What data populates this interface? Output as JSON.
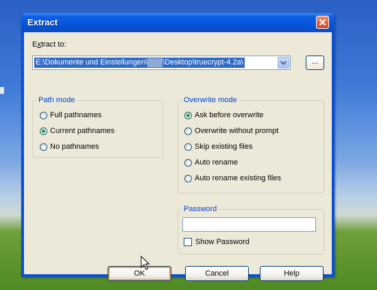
{
  "window": {
    "title": "Extract"
  },
  "extract_to": {
    "label_pre": "E",
    "label_u": "x",
    "label_post": "tract to:",
    "path_start": "E:\\Dokumente und Einstellungen\\",
    "path_end": "\\Desktop\\truecrypt-4.2a\\",
    "browse_label": "..."
  },
  "path_mode": {
    "title": "Path mode",
    "options": [
      {
        "label": "Full pathnames",
        "checked": false
      },
      {
        "label": "Current pathnames",
        "checked": true
      },
      {
        "label": "No pathnames",
        "checked": false
      }
    ]
  },
  "overwrite_mode": {
    "title": "Overwrite mode",
    "options": [
      {
        "label": "Ask before overwrite",
        "checked": true
      },
      {
        "label": "Overwrite without prompt",
        "checked": false
      },
      {
        "label": "Skip existing files",
        "checked": false
      },
      {
        "label": "Auto rename",
        "checked": false
      },
      {
        "label": "Auto rename existing files",
        "checked": false
      }
    ]
  },
  "password": {
    "title": "Password",
    "value": "",
    "show_label": "Show Password",
    "show_checked": false
  },
  "buttons": {
    "ok": "OK",
    "cancel": "Cancel",
    "help": "Help"
  },
  "colors": {
    "titlebar": "#0a4fd8",
    "dialog": "#ece9d8",
    "group_title": "#0046d5",
    "selection": "#316ac5"
  }
}
